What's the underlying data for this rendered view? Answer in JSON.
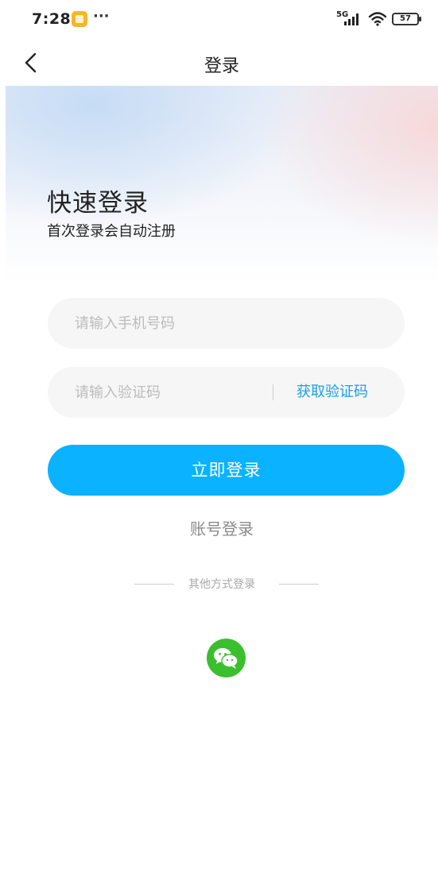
{
  "status_bar": {
    "time": "7:28",
    "more": "···",
    "network": "5G",
    "battery": "57",
    "icons": [
      "notification-app-icon",
      "signal-icon",
      "wifi-icon",
      "battery-icon"
    ]
  },
  "nav": {
    "back_icon": "chevron-left-icon",
    "title": "登录"
  },
  "hero": {
    "title": "快速登录",
    "subtitle": "首次登录会自动注册"
  },
  "form": {
    "phone_placeholder": "请输入手机号码",
    "phone_value": "",
    "code_placeholder": "请输入验证码",
    "code_value": "",
    "get_code_label": "获取验证码",
    "submit_label": "立即登录",
    "account_login_label": "账号登录"
  },
  "other_login": {
    "label": "其他方式登录",
    "methods": [
      {
        "name": "wechat",
        "icon": "wechat-icon"
      }
    ]
  },
  "colors": {
    "accent": "#0bb2ff",
    "link": "#1aa0e6",
    "wechat": "#3bbf2f",
    "field_bg": "#f6f6f6"
  }
}
